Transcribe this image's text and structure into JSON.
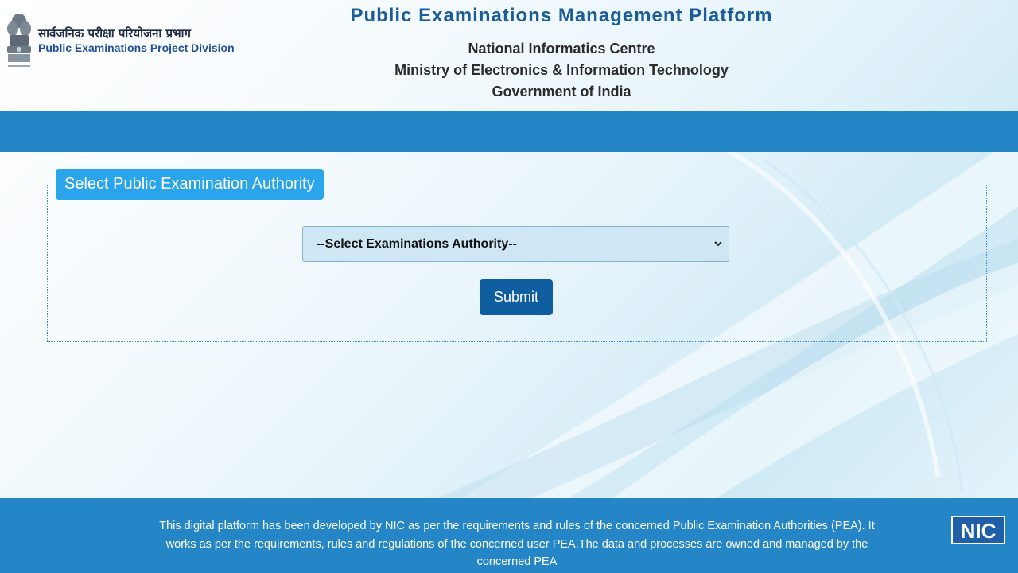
{
  "header": {
    "dept_hindi": "सार्वजनिक परीक्षा परियोजना प्रभाग",
    "dept_english": "Public Examinations Project Division",
    "title": "Public Examinations Management Platform",
    "org_line1": "National Informatics Centre",
    "org_line2": "Ministry of Electronics & Information Technology",
    "org_line3": "Government of India"
  },
  "form": {
    "legend": "Select Public Examination Authority",
    "select_value": "--Select Examinations Authority--",
    "submit_label": "Submit"
  },
  "footer": {
    "text": "This digital platform has been developed by NIC as per the requirements and rules of the concerned Public Examination Authorities (PEA). It works as per the requirements, rules and regulations of the concerned user PEA.The data and processes are owned and managed by the concerned PEA",
    "logo_text": "NIC"
  },
  "colors": {
    "title_blue": "#1a5d9a",
    "bar_blue": "#2486c7",
    "legend_blue": "#2aa4ea",
    "button_blue": "#0f5fa0",
    "select_bg": "#cfe7f4"
  },
  "icons": [
    "national-emblem-icon",
    "chevron-down-icon",
    "nic-logo"
  ]
}
